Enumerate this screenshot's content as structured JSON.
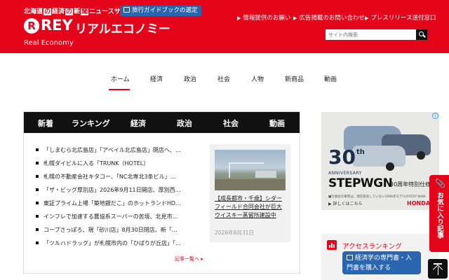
{
  "header": {
    "tagline_parts": [
      "北海道",
      "の",
      "経済",
      "の",
      "新",
      "聞",
      "ニュースサイト"
    ],
    "guide_button": "旅行ガイドブックの選定",
    "logo_mid": "REY",
    "logo_jp": "リアルエコノミー",
    "logo_en": "Real Economy",
    "top_links": [
      "情報提供のお願い",
      "広告掲載のお問い合わせ",
      "プレスリリース送付窓口"
    ],
    "search_placeholder": "サイト内検索",
    "brand_color": "#e4051a"
  },
  "nav": {
    "items": [
      "ホーム",
      "経済",
      "政治",
      "社会",
      "人物",
      "新商品",
      "動画"
    ],
    "active": "ホーム"
  },
  "panel": {
    "tabs": [
      "新着",
      "ランキング",
      "経済",
      "政治",
      "社会",
      "動画"
    ],
    "news": [
      "「しまむら北広島店」「アベイル北広島店」閉店へ、…",
      "札幌ダイビルに入る「TRUNK（HOTEL）",
      "札幌の不動産会社キタコー、「NC北専北3条ビル」…",
      "「ザ・ビッグ厚別店」2026年9月11日開店、厚別西…",
      "東証プライム上場「築地銀だこ」のホットランドHD…",
      "インフレで加速する農協系スーパーの苦境、北見市…",
      "コープさっぽろ、現「砂川店」8月30日閉店、新「…",
      "「ツルハドラッグ」が札幌市内の「ひばりが丘店」「…"
    ],
    "feature_caption": "【成長都市・千歳】シダーフィールド合同会社が巨大ウイスキー蒸留所建設中",
    "feature_date": "2026年8月31日",
    "more_label": "記事一覧へ ▸"
  },
  "ad": {
    "big_number": "30",
    "suffix": "th",
    "anniversary": "ANNIVERSARY",
    "brand": "STEPWGN",
    "model_label": "30周年特別仕様",
    "fine_print": "■写真左の車両は、現在販売していない1996年モデルのSTEP WGN",
    "detail_link": "▶ 詳しくはこちら",
    "maker": "HONDA",
    "info_icon": "i"
  },
  "sidebar": {
    "ranking_title": "アクセスランキング",
    "book_button": "経済学の専門書・入門書を購入する",
    "fav_label": "お気に入り記事",
    "clip_icon": "📎"
  }
}
